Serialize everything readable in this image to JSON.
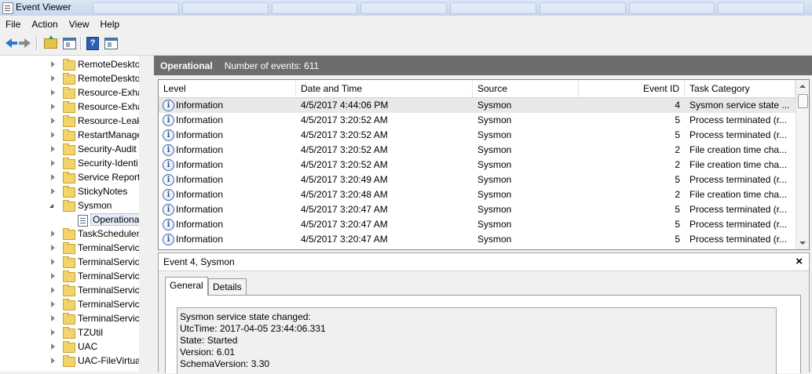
{
  "window": {
    "title": "Event Viewer",
    "ghost_tabs": [
      "",
      "",
      "",
      "",
      "",
      "",
      "",
      ""
    ]
  },
  "menu": [
    "File",
    "Action",
    "View",
    "Help"
  ],
  "toolbar": {
    "icons": [
      "back-arrow-icon",
      "forward-arrow-icon",
      "folder-up-icon",
      "show-hide-console-tree-icon",
      "help-icon",
      "show-hide-action-pane-icon"
    ]
  },
  "tree": {
    "items": [
      {
        "label": "RemoteDeskto",
        "type": "folder",
        "expanded": false
      },
      {
        "label": "RemoteDeskto",
        "type": "folder",
        "expanded": false
      },
      {
        "label": "Resource-Exha",
        "type": "folder",
        "expanded": false
      },
      {
        "label": "Resource-Exha",
        "type": "folder",
        "expanded": false
      },
      {
        "label": "Resource-Leak",
        "type": "folder",
        "expanded": false
      },
      {
        "label": "RestartManage",
        "type": "folder",
        "expanded": false
      },
      {
        "label": "Security-Audit",
        "type": "folder",
        "expanded": false
      },
      {
        "label": "Security-Identi",
        "type": "folder",
        "expanded": false
      },
      {
        "label": "Service Report",
        "type": "folder",
        "expanded": false
      },
      {
        "label": "StickyNotes",
        "type": "folder",
        "expanded": false
      },
      {
        "label": "Sysmon",
        "type": "folder",
        "expanded": true
      },
      {
        "label": "Operationa",
        "type": "log",
        "selected": true
      },
      {
        "label": "TaskScheduler",
        "type": "folder",
        "expanded": false
      },
      {
        "label": "TerminalServic",
        "type": "folder",
        "expanded": false
      },
      {
        "label": "TerminalServic",
        "type": "folder",
        "expanded": false
      },
      {
        "label": "TerminalServic",
        "type": "folder",
        "expanded": false
      },
      {
        "label": "TerminalServic",
        "type": "folder",
        "expanded": false
      },
      {
        "label": "TerminalServic",
        "type": "folder",
        "expanded": false
      },
      {
        "label": "TerminalServic",
        "type": "folder",
        "expanded": false
      },
      {
        "label": "TZUtil",
        "type": "folder",
        "expanded": false
      },
      {
        "label": "UAC",
        "type": "folder",
        "expanded": false
      },
      {
        "label": "UAC-FileVirtua",
        "type": "folder",
        "expanded": false
      }
    ]
  },
  "log_header": {
    "name": "Operational",
    "count_text": "Number of events: 611"
  },
  "grid": {
    "columns": [
      "Level",
      "Date and Time",
      "Source",
      "Event ID",
      "Task Category"
    ],
    "rows": [
      {
        "level": "Information",
        "datetime": "4/5/2017 4:44:06 PM",
        "source": "Sysmon",
        "event_id": "4",
        "category": "Sysmon service state ...",
        "selected": true
      },
      {
        "level": "Information",
        "datetime": "4/5/2017 3:20:52 AM",
        "source": "Sysmon",
        "event_id": "5",
        "category": "Process terminated (r..."
      },
      {
        "level": "Information",
        "datetime": "4/5/2017 3:20:52 AM",
        "source": "Sysmon",
        "event_id": "5",
        "category": "Process terminated (r..."
      },
      {
        "level": "Information",
        "datetime": "4/5/2017 3:20:52 AM",
        "source": "Sysmon",
        "event_id": "2",
        "category": "File creation time cha..."
      },
      {
        "level": "Information",
        "datetime": "4/5/2017 3:20:52 AM",
        "source": "Sysmon",
        "event_id": "2",
        "category": "File creation time cha..."
      },
      {
        "level": "Information",
        "datetime": "4/5/2017 3:20:49 AM",
        "source": "Sysmon",
        "event_id": "5",
        "category": "Process terminated (r..."
      },
      {
        "level": "Information",
        "datetime": "4/5/2017 3:20:48 AM",
        "source": "Sysmon",
        "event_id": "2",
        "category": "File creation time cha..."
      },
      {
        "level": "Information",
        "datetime": "4/5/2017 3:20:47 AM",
        "source": "Sysmon",
        "event_id": "5",
        "category": "Process terminated (r..."
      },
      {
        "level": "Information",
        "datetime": "4/5/2017 3:20:47 AM",
        "source": "Sysmon",
        "event_id": "5",
        "category": "Process terminated (r..."
      },
      {
        "level": "Information",
        "datetime": "4/5/2017 3:20:47 AM",
        "source": "Sysmon",
        "event_id": "5",
        "category": "Process terminated (r..."
      }
    ]
  },
  "detail": {
    "title": "Event 4, Sysmon",
    "close": "×",
    "tabs": [
      "General",
      "Details"
    ],
    "active_tab": "General",
    "lines": [
      "Sysmon service state changed:",
      "UtcTime: 2017-04-05 23:44:06.331",
      "State: Started",
      "Version: 6.01",
      "SchemaVersion: 3.30"
    ]
  }
}
